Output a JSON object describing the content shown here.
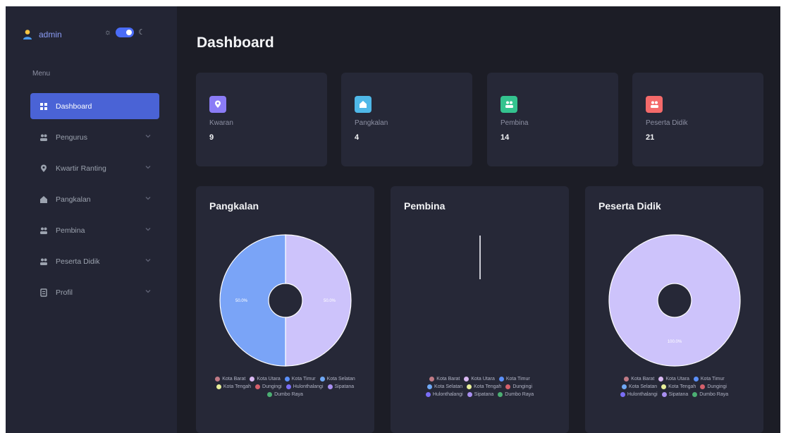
{
  "user": {
    "name": "admin"
  },
  "sidebar": {
    "menu_label": "Menu",
    "items": [
      {
        "label": "Dashboard",
        "icon": "grid-icon",
        "active": true,
        "expandable": false
      },
      {
        "label": "Pengurus",
        "icon": "users-icon",
        "active": false,
        "expandable": true
      },
      {
        "label": "Kwartir Ranting",
        "icon": "map-pin-icon",
        "active": false,
        "expandable": true
      },
      {
        "label": "Pangkalan",
        "icon": "home-icon",
        "active": false,
        "expandable": true
      },
      {
        "label": "Pembina",
        "icon": "users-icon",
        "active": false,
        "expandable": true
      },
      {
        "label": "Peserta Didik",
        "icon": "users-icon",
        "active": false,
        "expandable": true
      },
      {
        "label": "Profil",
        "icon": "document-icon",
        "active": false,
        "expandable": true
      }
    ]
  },
  "page": {
    "title": "Dashboard"
  },
  "stats": [
    {
      "label": "Kwaran",
      "value": "9",
      "icon": "map-pin-icon",
      "color": "#8b7cf6"
    },
    {
      "label": "Pangkalan",
      "value": "4",
      "icon": "home-icon",
      "color": "#4fb8e8"
    },
    {
      "label": "Pembina",
      "value": "14",
      "icon": "users-icon",
      "color": "#34c38f"
    },
    {
      "label": "Peserta Didik",
      "value": "21",
      "icon": "users-icon",
      "color": "#f46a6a"
    }
  ],
  "colors": {
    "accent": "#4a63d6",
    "legend": {
      "Kota Barat": "#c07a85",
      "Kota Utara": "#d9b8f2",
      "Kota Timur": "#5b8ff9",
      "Kota Selatan": "#6fa8f5",
      "Kota Tengah": "#e8ef9a",
      "Dungingi": "#d4606b",
      "Hulonthalangi": "#7a6ef6",
      "Sipatana": "#a88ff0",
      "Dumbo Raya": "#4caf73"
    }
  },
  "chart_data": [
    {
      "type": "pie",
      "title": "Pangkalan",
      "labels": [
        "Kota Barat",
        "Kota Utara",
        "Kota Timur",
        "Kota Selatan",
        "Kota Tengah",
        "Dungingi",
        "Hulonthalangi",
        "Sipatana",
        "Dumbo Raya"
      ],
      "values": [
        0,
        2,
        2,
        0,
        0,
        0,
        0,
        0,
        0
      ],
      "slice_labels": [
        "50.0%",
        "50.0%"
      ],
      "slice_colors": [
        "#cdc3fb",
        "#7aa4f7"
      ]
    },
    {
      "type": "pie",
      "title": "Pembina",
      "labels": [
        "Kota Barat",
        "Kota Utara",
        "Kota Timur",
        "Kota Selatan",
        "Kota Tengah",
        "Dungingi",
        "Hulonthalangi",
        "Sipatana",
        "Dumbo Raya"
      ],
      "values": [
        0,
        0,
        0,
        0,
        0,
        0,
        0,
        0,
        0
      ],
      "slice_labels": [],
      "slice_colors": []
    },
    {
      "type": "pie",
      "title": "Peserta Didik",
      "labels": [
        "Kota Barat",
        "Kota Utara",
        "Kota Timur",
        "Kota Selatan",
        "Kota Tengah",
        "Dungingi",
        "Hulonthalangi",
        "Sipatana",
        "Dumbo Raya"
      ],
      "values": [
        0,
        21,
        0,
        0,
        0,
        0,
        0,
        0,
        0
      ],
      "slice_labels": [
        "100.0%"
      ],
      "slice_colors": [
        "#cdc3fb"
      ]
    }
  ]
}
